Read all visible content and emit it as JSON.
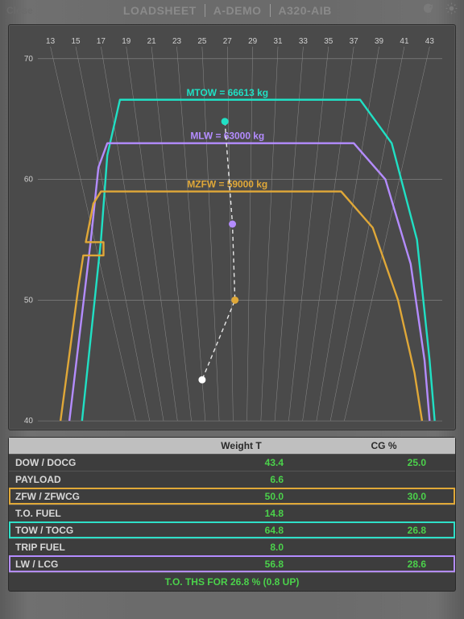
{
  "header": {
    "close": "Close",
    "crumbs": [
      "LOADSHEET",
      "A-DEMO",
      "A320-AIB"
    ]
  },
  "icons": {
    "refresh": "refresh-icon",
    "brightness": "brightness-icon"
  },
  "chart_data": {
    "type": "line",
    "x_axis": {
      "label": "CG %",
      "min": 12,
      "max": 44,
      "ticks": [
        13,
        15,
        17,
        19,
        21,
        23,
        25,
        27,
        29,
        31,
        33,
        35,
        37,
        39,
        41,
        43
      ]
    },
    "y_axis": {
      "label": "Weight T",
      "min": 40,
      "max": 71,
      "ticks": [
        40,
        50,
        60,
        70
      ]
    },
    "envelopes": [
      {
        "name": "MTOW",
        "label": "MTOW = 66613 kg",
        "color": "#20e0c4",
        "points": [
          [
            15.5,
            40
          ],
          [
            17,
            55
          ],
          [
            17.5,
            62
          ],
          [
            18.5,
            66.6
          ],
          [
            37.5,
            66.6
          ],
          [
            40,
            63
          ],
          [
            42,
            55
          ],
          [
            43,
            45
          ],
          [
            43.4,
            40
          ]
        ]
      },
      {
        "name": "MLW",
        "label": "MLW = 63000 kg",
        "color": "#b48cff",
        "points": [
          [
            14.5,
            40
          ],
          [
            16.2,
            55
          ],
          [
            16.8,
            61
          ],
          [
            17.5,
            63
          ],
          [
            37,
            63
          ],
          [
            39.5,
            60
          ],
          [
            41.5,
            53
          ],
          [
            42.6,
            45
          ],
          [
            43,
            40
          ]
        ]
      },
      {
        "name": "MZFW",
        "label": "MZFW = 59000 kg",
        "color": "#e0a838",
        "points": [
          [
            13.8,
            40
          ],
          [
            15.2,
            51
          ],
          [
            15.6,
            53.7
          ],
          [
            17.2,
            53.7
          ],
          [
            17.2,
            54.8
          ],
          [
            15.8,
            54.8
          ],
          [
            16.4,
            58
          ],
          [
            17,
            59
          ],
          [
            36,
            59
          ],
          [
            38.5,
            56
          ],
          [
            40.5,
            50
          ],
          [
            41.8,
            44
          ],
          [
            42.4,
            40
          ]
        ]
      }
    ],
    "points": [
      {
        "name": "TOW",
        "cg": 26.8,
        "weight": 64.8,
        "color": "#20e0c4"
      },
      {
        "name": "LW",
        "cg": 27.4,
        "weight": 56.3,
        "color": "#b48cff"
      },
      {
        "name": "ZFW",
        "cg": 27.6,
        "weight": 50.0,
        "color": "#e0a838"
      },
      {
        "name": "DOW",
        "cg": 25.0,
        "weight": 43.4,
        "color": "#ffffff"
      }
    ],
    "connectors": "dashed-white"
  },
  "table": {
    "headers": {
      "weight": "Weight T",
      "cg": "CG %"
    },
    "rows": [
      {
        "label": "DOW / DOCG",
        "w": "43.4",
        "cg": "25.0",
        "hl": ""
      },
      {
        "label": "PAYLOAD",
        "w": "6.6",
        "cg": "",
        "hl": ""
      },
      {
        "label": "ZFW / ZFWCG",
        "w": "50.0",
        "cg": "30.0",
        "hl": "zfw"
      },
      {
        "label": "T.O. FUEL",
        "w": "14.8",
        "cg": "",
        "hl": ""
      },
      {
        "label": "TOW / TOCG",
        "w": "64.8",
        "cg": "26.8",
        "hl": "tow"
      },
      {
        "label": "TRIP FUEL",
        "w": "8.0",
        "cg": "",
        "hl": ""
      },
      {
        "label": "LW / LCG",
        "w": "56.8",
        "cg": "28.6",
        "hl": "lw"
      }
    ],
    "footer": "T.O. THS FOR 26.8 % (0.8 UP)"
  }
}
